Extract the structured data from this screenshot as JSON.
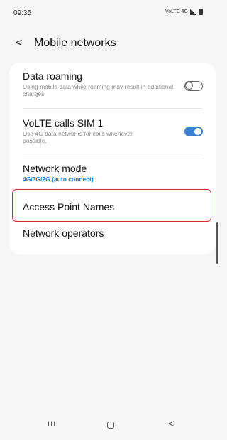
{
  "status_bar": {
    "time": "09:35",
    "network_label": "VoLTE 4G"
  },
  "header": {
    "back_glyph": "<",
    "title": "Mobile networks"
  },
  "settings": [
    {
      "title": "Data roaming",
      "subtitle": "Using mobile data while roaming may result in additional charges.",
      "toggle": "off"
    },
    {
      "title": "VoLTE calls SIM 1",
      "subtitle": "Use 4G data networks for calls whenever possible.",
      "toggle": "on"
    },
    {
      "title": "Network mode",
      "subtitle": "4G/3G/2G (auto connect)"
    },
    {
      "title": "Access Point Names"
    },
    {
      "title": "Network operators"
    }
  ],
  "nav_bar": {
    "recent_glyph": "III",
    "back_glyph": "<"
  },
  "colors": {
    "accent": "#3b82d6",
    "highlight": "#d22a2a",
    "background": "#f6f6f6",
    "card": "#ffffff"
  }
}
